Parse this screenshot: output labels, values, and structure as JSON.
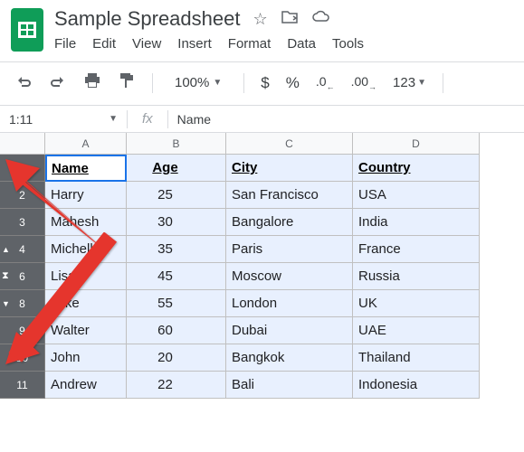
{
  "doc": {
    "title": "Sample Spreadsheet"
  },
  "menu": {
    "file": "File",
    "edit": "Edit",
    "view": "View",
    "insert": "Insert",
    "format": "Format",
    "data": "Data",
    "tools": "Tools"
  },
  "toolbar": {
    "zoom": "100%",
    "num_fmt": "123"
  },
  "namebox": {
    "ref": "1:11"
  },
  "formula": {
    "value": "Name"
  },
  "columns": [
    "A",
    "B",
    "C",
    "D"
  ],
  "headers": {
    "name": "Name",
    "age": "Age",
    "city": "City",
    "country": "Country"
  },
  "rows": [
    {
      "num": "1"
    },
    {
      "num": "2",
      "name": "Harry",
      "age": "25",
      "city": "San Francisco",
      "country": "USA"
    },
    {
      "num": "3",
      "name": "Mahesh",
      "age": "30",
      "city": "Bangalore",
      "country": "India"
    },
    {
      "num": "4",
      "name": "Michelle",
      "age": "35",
      "city": "Paris",
      "country": "France"
    },
    {
      "num": "6",
      "name": "Lisa",
      "age": "45",
      "city": "Moscow",
      "country": "Russia"
    },
    {
      "num": "8",
      "name": "Mike",
      "age": "55",
      "city": "London",
      "country": "UK"
    },
    {
      "num": "9",
      "name": "Walter",
      "age": "60",
      "city": "Dubai",
      "country": "UAE"
    },
    {
      "num": "10",
      "name": "John",
      "age": "20",
      "city": "Bangkok",
      "country": "Thailand"
    },
    {
      "num": "11",
      "name": "Andrew",
      "age": "22",
      "city": "Bali",
      "country": "Indonesia"
    }
  ]
}
